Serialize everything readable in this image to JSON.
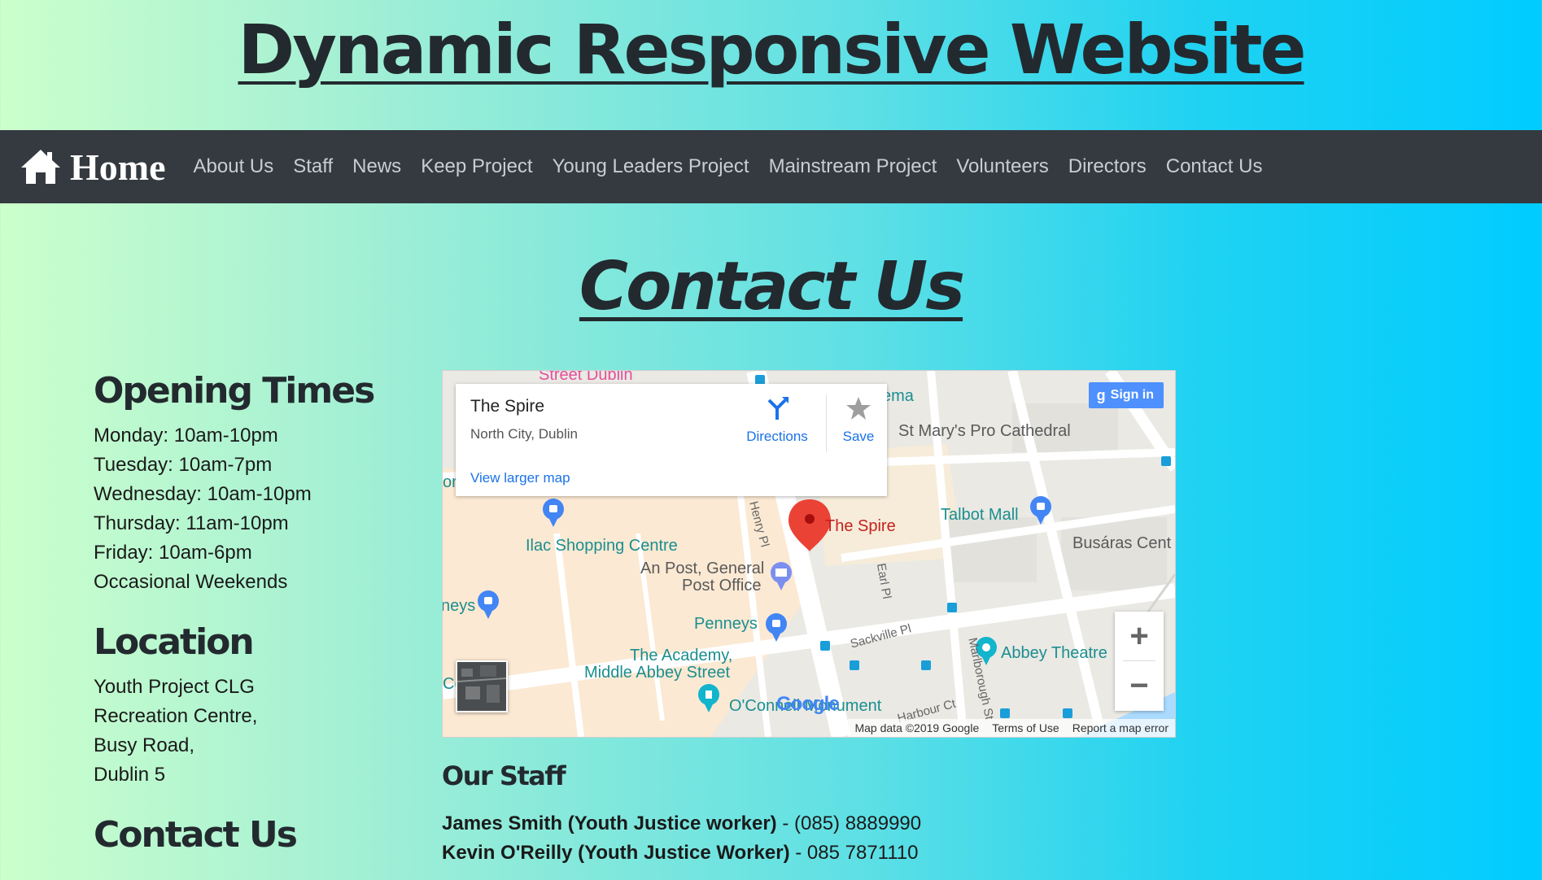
{
  "site": {
    "title": "Dynamic Responsive Website"
  },
  "nav": {
    "brand": "Home",
    "links": [
      "About Us",
      "Staff",
      "News",
      "Keep Project",
      "Young Leaders Project",
      "Mainstream Project",
      "Volunteers",
      "Directors",
      "Contact Us"
    ]
  },
  "page": {
    "heading": "Contact Us"
  },
  "sidebar": {
    "opening": {
      "title": "Opening Times",
      "lines": [
        "Monday: 10am-10pm",
        "Tuesday: 10am-7pm",
        "Wednesday: 10am-10pm",
        "Thursday: 11am-10pm",
        "Friday: 10am-6pm",
        "Occasional Weekends"
      ]
    },
    "location": {
      "title": "Location",
      "lines": [
        "Youth Project CLG",
        "Recreation Centre,",
        "Busy Road,",
        "Dublin 5"
      ]
    },
    "contact": {
      "title": "Contact Us"
    }
  },
  "map": {
    "place_name": "The Spire",
    "place_area": "North City, Dublin",
    "directions": "Directions",
    "save": "Save",
    "view_larger": "View larger map",
    "sign_in": "Sign in",
    "zoom_in": "+",
    "zoom_out": "−",
    "footer": {
      "data": "Map data ©2019 Google",
      "terms": "Terms of Use",
      "report": "Report a map error"
    },
    "logo": "Google",
    "labels": {
      "street_dublin": "Street Dublin",
      "cinema": "ema",
      "cathedral": "St Mary's Pro Cathedral",
      "talbot": "Talbot Mall",
      "busaras": "Busáras Cent",
      "ilac": "Ilac Shopping Centre",
      "gpo_1": "An Post, General",
      "gpo_2": "Post Office",
      "spire": "The Spire",
      "penneys": "Penneys",
      "penneys_left": "neys",
      "academy_1": "The Academy,",
      "academy_2": "Middle Abbey Street",
      "abbey": "Abbey Theatre",
      "oconnell": "O'Connell Monument",
      "henry": "Henry Pl",
      "earl": "Earl Pl",
      "sackville": "Sackville Pl",
      "marlborough": "Marlborough St",
      "harbour": "Harbour Ct",
      "left_cut": "orl",
      "left_ce": "Ce"
    },
    "colors": {
      "water": "#aadaff",
      "shopping": "#fbe9d3",
      "road": "#ffffff",
      "land": "#eae9e4",
      "pin": "#ea4335"
    }
  },
  "staff": {
    "title": "Our Staff",
    "members": [
      {
        "name": "James Smith (Youth Justice worker)",
        "phone": " - (085) 8889990"
      },
      {
        "name": "Kevin O'Reilly (Youth Justice Worker)",
        "phone": " - 085 7871110"
      }
    ]
  }
}
